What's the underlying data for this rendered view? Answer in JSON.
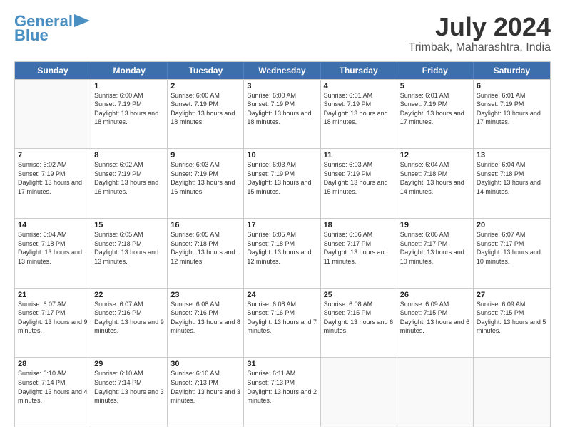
{
  "logo": {
    "line1": "General",
    "line2": "Blue"
  },
  "title": "July 2024",
  "subtitle": "Trimbak, Maharashtra, India",
  "header_days": [
    "Sunday",
    "Monday",
    "Tuesday",
    "Wednesday",
    "Thursday",
    "Friday",
    "Saturday"
  ],
  "weeks": [
    [
      {
        "day": "",
        "sunrise": "",
        "sunset": "",
        "daylight": ""
      },
      {
        "day": "1",
        "sunrise": "Sunrise: 6:00 AM",
        "sunset": "Sunset: 7:19 PM",
        "daylight": "Daylight: 13 hours and 18 minutes."
      },
      {
        "day": "2",
        "sunrise": "Sunrise: 6:00 AM",
        "sunset": "Sunset: 7:19 PM",
        "daylight": "Daylight: 13 hours and 18 minutes."
      },
      {
        "day": "3",
        "sunrise": "Sunrise: 6:00 AM",
        "sunset": "Sunset: 7:19 PM",
        "daylight": "Daylight: 13 hours and 18 minutes."
      },
      {
        "day": "4",
        "sunrise": "Sunrise: 6:01 AM",
        "sunset": "Sunset: 7:19 PM",
        "daylight": "Daylight: 13 hours and 18 minutes."
      },
      {
        "day": "5",
        "sunrise": "Sunrise: 6:01 AM",
        "sunset": "Sunset: 7:19 PM",
        "daylight": "Daylight: 13 hours and 17 minutes."
      },
      {
        "day": "6",
        "sunrise": "Sunrise: 6:01 AM",
        "sunset": "Sunset: 7:19 PM",
        "daylight": "Daylight: 13 hours and 17 minutes."
      }
    ],
    [
      {
        "day": "7",
        "sunrise": "Sunrise: 6:02 AM",
        "sunset": "Sunset: 7:19 PM",
        "daylight": "Daylight: 13 hours and 17 minutes."
      },
      {
        "day": "8",
        "sunrise": "Sunrise: 6:02 AM",
        "sunset": "Sunset: 7:19 PM",
        "daylight": "Daylight: 13 hours and 16 minutes."
      },
      {
        "day": "9",
        "sunrise": "Sunrise: 6:03 AM",
        "sunset": "Sunset: 7:19 PM",
        "daylight": "Daylight: 13 hours and 16 minutes."
      },
      {
        "day": "10",
        "sunrise": "Sunrise: 6:03 AM",
        "sunset": "Sunset: 7:19 PM",
        "daylight": "Daylight: 13 hours and 15 minutes."
      },
      {
        "day": "11",
        "sunrise": "Sunrise: 6:03 AM",
        "sunset": "Sunset: 7:19 PM",
        "daylight": "Daylight: 13 hours and 15 minutes."
      },
      {
        "day": "12",
        "sunrise": "Sunrise: 6:04 AM",
        "sunset": "Sunset: 7:18 PM",
        "daylight": "Daylight: 13 hours and 14 minutes."
      },
      {
        "day": "13",
        "sunrise": "Sunrise: 6:04 AM",
        "sunset": "Sunset: 7:18 PM",
        "daylight": "Daylight: 13 hours and 14 minutes."
      }
    ],
    [
      {
        "day": "14",
        "sunrise": "Sunrise: 6:04 AM",
        "sunset": "Sunset: 7:18 PM",
        "daylight": "Daylight: 13 hours and 13 minutes."
      },
      {
        "day": "15",
        "sunrise": "Sunrise: 6:05 AM",
        "sunset": "Sunset: 7:18 PM",
        "daylight": "Daylight: 13 hours and 13 minutes."
      },
      {
        "day": "16",
        "sunrise": "Sunrise: 6:05 AM",
        "sunset": "Sunset: 7:18 PM",
        "daylight": "Daylight: 13 hours and 12 minutes."
      },
      {
        "day": "17",
        "sunrise": "Sunrise: 6:05 AM",
        "sunset": "Sunset: 7:18 PM",
        "daylight": "Daylight: 13 hours and 12 minutes."
      },
      {
        "day": "18",
        "sunrise": "Sunrise: 6:06 AM",
        "sunset": "Sunset: 7:17 PM",
        "daylight": "Daylight: 13 hours and 11 minutes."
      },
      {
        "day": "19",
        "sunrise": "Sunrise: 6:06 AM",
        "sunset": "Sunset: 7:17 PM",
        "daylight": "Daylight: 13 hours and 10 minutes."
      },
      {
        "day": "20",
        "sunrise": "Sunrise: 6:07 AM",
        "sunset": "Sunset: 7:17 PM",
        "daylight": "Daylight: 13 hours and 10 minutes."
      }
    ],
    [
      {
        "day": "21",
        "sunrise": "Sunrise: 6:07 AM",
        "sunset": "Sunset: 7:17 PM",
        "daylight": "Daylight: 13 hours and 9 minutes."
      },
      {
        "day": "22",
        "sunrise": "Sunrise: 6:07 AM",
        "sunset": "Sunset: 7:16 PM",
        "daylight": "Daylight: 13 hours and 9 minutes."
      },
      {
        "day": "23",
        "sunrise": "Sunrise: 6:08 AM",
        "sunset": "Sunset: 7:16 PM",
        "daylight": "Daylight: 13 hours and 8 minutes."
      },
      {
        "day": "24",
        "sunrise": "Sunrise: 6:08 AM",
        "sunset": "Sunset: 7:16 PM",
        "daylight": "Daylight: 13 hours and 7 minutes."
      },
      {
        "day": "25",
        "sunrise": "Sunrise: 6:08 AM",
        "sunset": "Sunset: 7:15 PM",
        "daylight": "Daylight: 13 hours and 6 minutes."
      },
      {
        "day": "26",
        "sunrise": "Sunrise: 6:09 AM",
        "sunset": "Sunset: 7:15 PM",
        "daylight": "Daylight: 13 hours and 6 minutes."
      },
      {
        "day": "27",
        "sunrise": "Sunrise: 6:09 AM",
        "sunset": "Sunset: 7:15 PM",
        "daylight": "Daylight: 13 hours and 5 minutes."
      }
    ],
    [
      {
        "day": "28",
        "sunrise": "Sunrise: 6:10 AM",
        "sunset": "Sunset: 7:14 PM",
        "daylight": "Daylight: 13 hours and 4 minutes."
      },
      {
        "day": "29",
        "sunrise": "Sunrise: 6:10 AM",
        "sunset": "Sunset: 7:14 PM",
        "daylight": "Daylight: 13 hours and 3 minutes."
      },
      {
        "day": "30",
        "sunrise": "Sunrise: 6:10 AM",
        "sunset": "Sunset: 7:13 PM",
        "daylight": "Daylight: 13 hours and 3 minutes."
      },
      {
        "day": "31",
        "sunrise": "Sunrise: 6:11 AM",
        "sunset": "Sunset: 7:13 PM",
        "daylight": "Daylight: 13 hours and 2 minutes."
      },
      {
        "day": "",
        "sunrise": "",
        "sunset": "",
        "daylight": ""
      },
      {
        "day": "",
        "sunrise": "",
        "sunset": "",
        "daylight": ""
      },
      {
        "day": "",
        "sunrise": "",
        "sunset": "",
        "daylight": ""
      }
    ]
  ]
}
